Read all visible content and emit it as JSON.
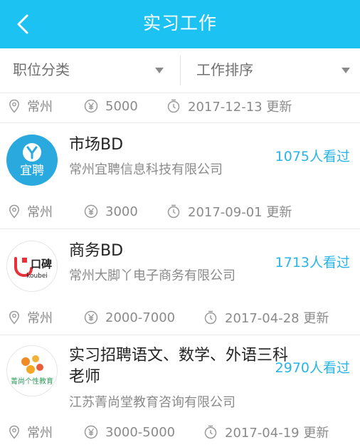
{
  "header": {
    "title": "实习工作"
  },
  "filters": {
    "category": "职位分类",
    "sort": "工作排序"
  },
  "top_meta": {
    "city": "常州",
    "salary": "5000",
    "updated": "2017-12-13 更新"
  },
  "jobs": [
    {
      "title": "市场BD",
      "company": "常州宜聘信息科技有限公司",
      "views": "1075人看过",
      "logo_text": "宜聘",
      "city": "常州",
      "salary": "3000",
      "updated": "2017-09-01 更新"
    },
    {
      "title": "商务BD",
      "company": "常州大脚丫电子商务有限公司",
      "views": "1713人看过",
      "logo_text": "口碑",
      "logo_sub": "koubei",
      "city": "常州",
      "salary": "2000-7000",
      "updated": "2017-04-28 更新"
    },
    {
      "title_line1": "实习招聘语文、数学、外语三科",
      "title_line2": "老师",
      "company": "江苏菁尚堂教育咨询有限公司",
      "views": "2970人看过",
      "logo_text": "菁尚个性教育",
      "city": "常州",
      "salary": "3000-5000",
      "updated": "2017-04-19 更新"
    }
  ],
  "colors": {
    "header": "#1cc3f2",
    "views": "#27b5e8"
  },
  "icons": [
    "back-arrow-icon",
    "dropdown-arrow-icon",
    "location-pin-icon",
    "yen-icon",
    "clock-icon"
  ]
}
